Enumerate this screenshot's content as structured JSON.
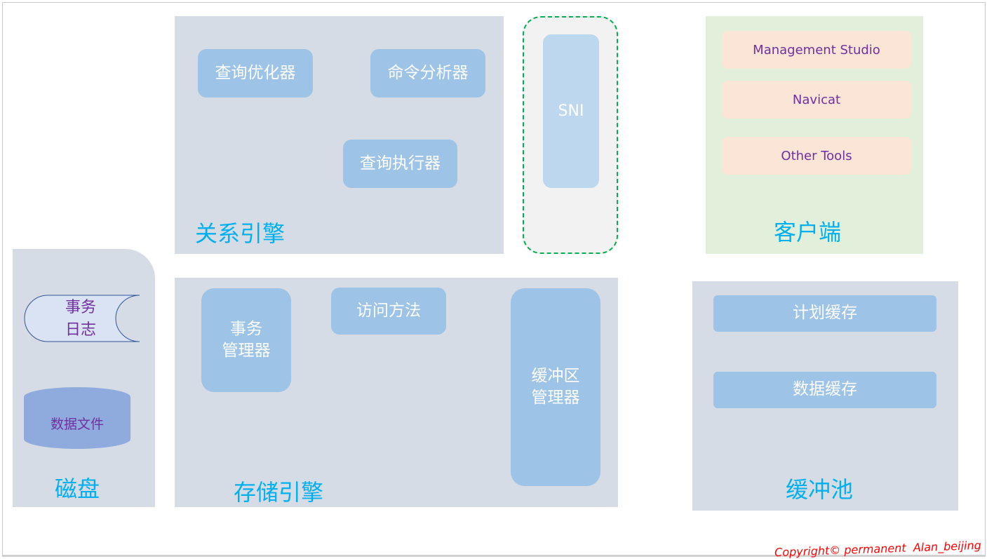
{
  "relational_engine": {
    "title": "关系引擎",
    "components": [
      "查询优化器",
      "命令分析器",
      "查询执行器"
    ]
  },
  "sni": {
    "label": "SNI"
  },
  "client": {
    "title": "客户端",
    "tools": [
      "Management Studio",
      "Navicat",
      "Other Tools"
    ]
  },
  "disk": {
    "title": "磁盘",
    "transaction_log": "事务\n日志",
    "data_file": "数据文件"
  },
  "storage_engine": {
    "title": "存储引擎",
    "transaction_manager": "事务\n管理器",
    "access_methods": "访问方法",
    "buffer_manager": "缓冲区\n管理器"
  },
  "buffer_pool": {
    "title": "缓冲池",
    "plan_cache": "计划缓存",
    "data_cache": "数据缓存"
  },
  "copyright": "Copyright© permanent  Alan_beijing",
  "colors": {
    "panel": "#d6dce5",
    "component": "#9dc3e6",
    "title": "#00b0f0",
    "client_bg": "#e2efda",
    "client_item": "#fbe5d6",
    "sni_border": "#00b050",
    "copyright": "#ff0000"
  }
}
